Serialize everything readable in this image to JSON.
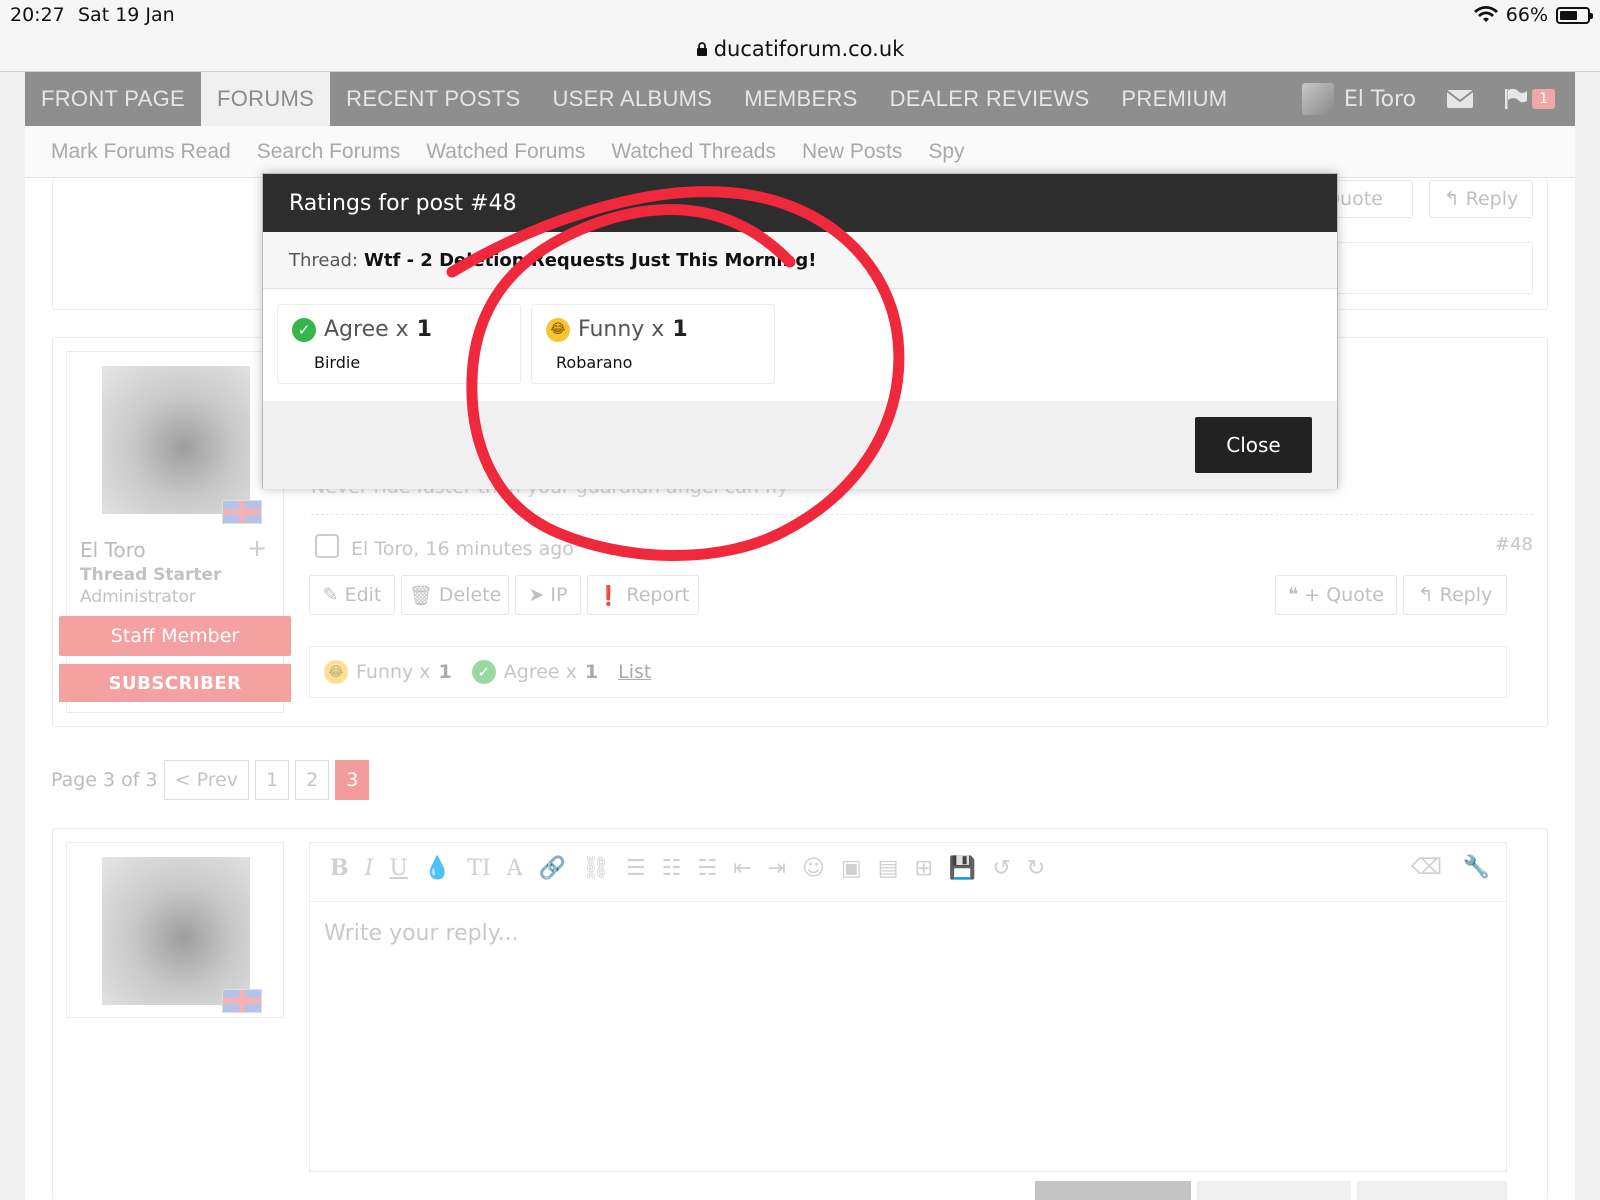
{
  "status_bar": {
    "time": "20:27",
    "date": "Sat 19 Jan",
    "battery": "66%",
    "battery_level": 0.66
  },
  "browser": {
    "url": "ducatiforum.co.uk"
  },
  "nav": {
    "tabs": [
      "FRONT PAGE",
      "FORUMS",
      "RECENT POSTS",
      "USER ALBUMS",
      "MEMBERS",
      "DEALER REVIEWS",
      "PREMIUM"
    ],
    "active_tab": "FORUMS",
    "user_name": "El Toro",
    "alerts_count": "1"
  },
  "subnav": [
    "Mark Forums Read",
    "Search Forums",
    "Watched Forums",
    "Watched Threads",
    "New Posts",
    "Spy"
  ],
  "prev_post": {
    "quote_label": "+ Quote",
    "reply_label": "Reply"
  },
  "post": {
    "author": "El Toro",
    "role": "Thread Starter",
    "title": "Administrator",
    "staff_tag": "Staff Member",
    "subscriber_tag": "SUBSCRIBER",
    "signature": "Never ride faster than your guardian angel can fly",
    "meta": "El Toro, 16 minutes ago",
    "post_number": "#48",
    "actions": {
      "edit": "Edit",
      "delete": "Delete",
      "ip": "IP",
      "report": "Report",
      "quote": "+ Quote",
      "reply": "Reply"
    },
    "ratings_bar": {
      "funny": "Funny x",
      "funny_count": "1",
      "agree": "Agree x",
      "agree_count": "1",
      "list": "List"
    }
  },
  "pagination": {
    "label": "Page 3 of 3",
    "prev": "< Prev",
    "pages": [
      "1",
      "2",
      "3"
    ],
    "current": "3"
  },
  "editor": {
    "placeholder": "Write your reply..."
  },
  "modal": {
    "title": "Ratings for post #48",
    "thread_label": "Thread:",
    "thread_title": "Wtf - 2 Deletion Requests Just This Morning!",
    "ratings": [
      {
        "label": "Agree x",
        "count": "1",
        "user": "Birdie",
        "icon": "check-icon"
      },
      {
        "label": "Funny x",
        "count": "1",
        "user": "Robarano",
        "icon": "laugh-icon"
      }
    ],
    "close_label": "Close"
  },
  "colors": {
    "annotation_red": "#f0283c",
    "accent_pink": "#f4a1a1",
    "nav_grey": "#8e8e8e",
    "modal_header": "#2d2d2d"
  }
}
